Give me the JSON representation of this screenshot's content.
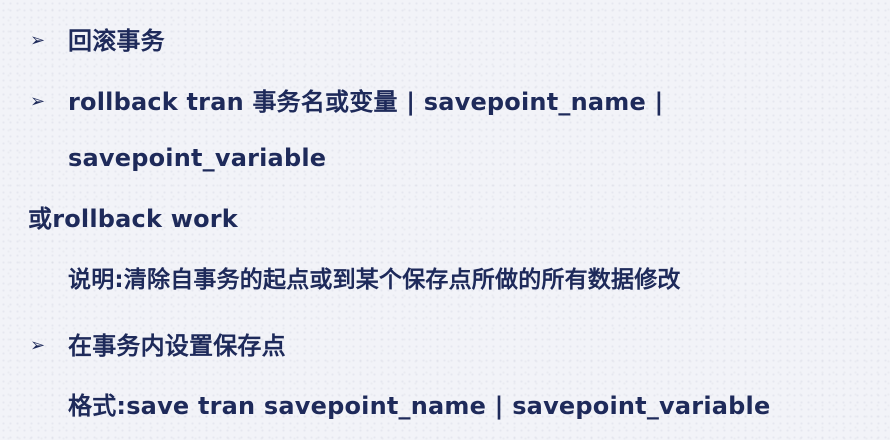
{
  "bullet_glyph": "➢",
  "lines": [
    {
      "text": "回滚事务",
      "bullet": true
    },
    {
      "text": "rollback tran 事务名或变量 | savepoint_name |",
      "bullet": true
    },
    {
      "text": "savepoint_variable",
      "bullet": false
    },
    {
      "text": "或rollback work",
      "bullet": false
    },
    {
      "text": "说明:清除自事务的起点或到某个保存点所做的所有数据修改",
      "bullet": false
    },
    {
      "text": "在事务内设置保存点",
      "bullet": true
    },
    {
      "text": "格式:save tran savepoint_name | savepoint_variable",
      "bullet": false
    }
  ],
  "colors": {
    "text": "#1e2a5a",
    "background": "#f2f3f8"
  }
}
